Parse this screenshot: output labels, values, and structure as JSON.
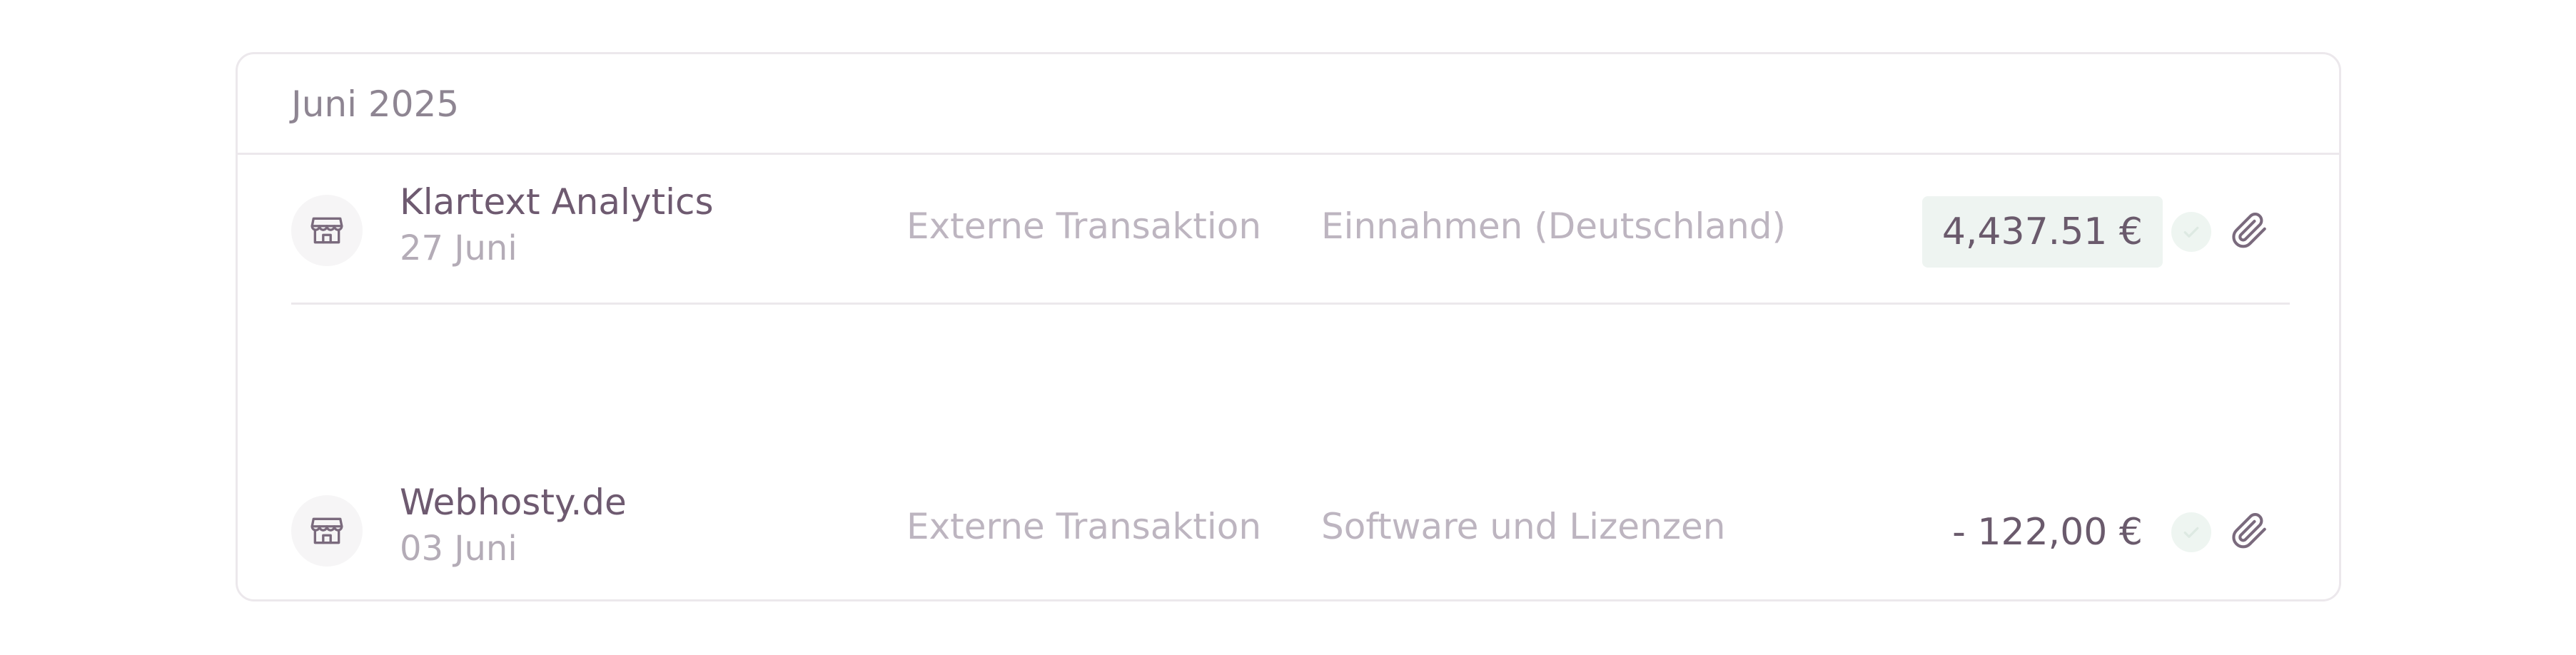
{
  "month_group": {
    "label": "Juni 2025"
  },
  "transactions": [
    {
      "merchant": "Klartext Analytics",
      "date": "27 Juni",
      "type": "Externe Transaktion",
      "category": "Einnahmen (Deutschland)",
      "amount": "4,437.51 €",
      "amount_highlighted": true,
      "status_icon": "check-icon",
      "attachment_icon": "paperclip-icon",
      "merchant_icon": "storefront-icon"
    },
    {
      "merchant": "Webhosty.de",
      "date": "03 Juni",
      "type": "Externe Transaktion",
      "category": "Software und Lizenzen",
      "amount": "- 122,00 €",
      "amount_highlighted": false,
      "status_icon": "check-icon",
      "attachment_icon": "paperclip-icon",
      "merchant_icon": "storefront-icon"
    }
  ],
  "colors": {
    "primary_text": "#6e5a70",
    "muted_text": "#bdb5c0",
    "income_highlight_bg": "#eef4f1",
    "border": "#ece8ec"
  }
}
